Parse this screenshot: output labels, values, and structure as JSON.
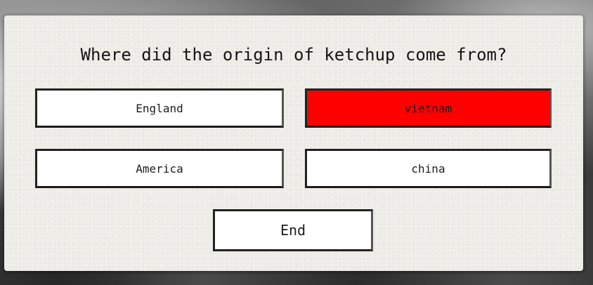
{
  "quiz": {
    "question": "Where did the origin of ketchup come from?",
    "answers": [
      {
        "label": "England",
        "selected": false
      },
      {
        "label": "vietnam",
        "selected": true
      },
      {
        "label": "America",
        "selected": false
      },
      {
        "label": "china",
        "selected": false
      }
    ],
    "end_label": "End"
  },
  "colors": {
    "card_background": "#efede8",
    "selected_answer": "#ff0000",
    "answer_background": "#ffffff",
    "border": "#222222",
    "text": "#141414"
  }
}
